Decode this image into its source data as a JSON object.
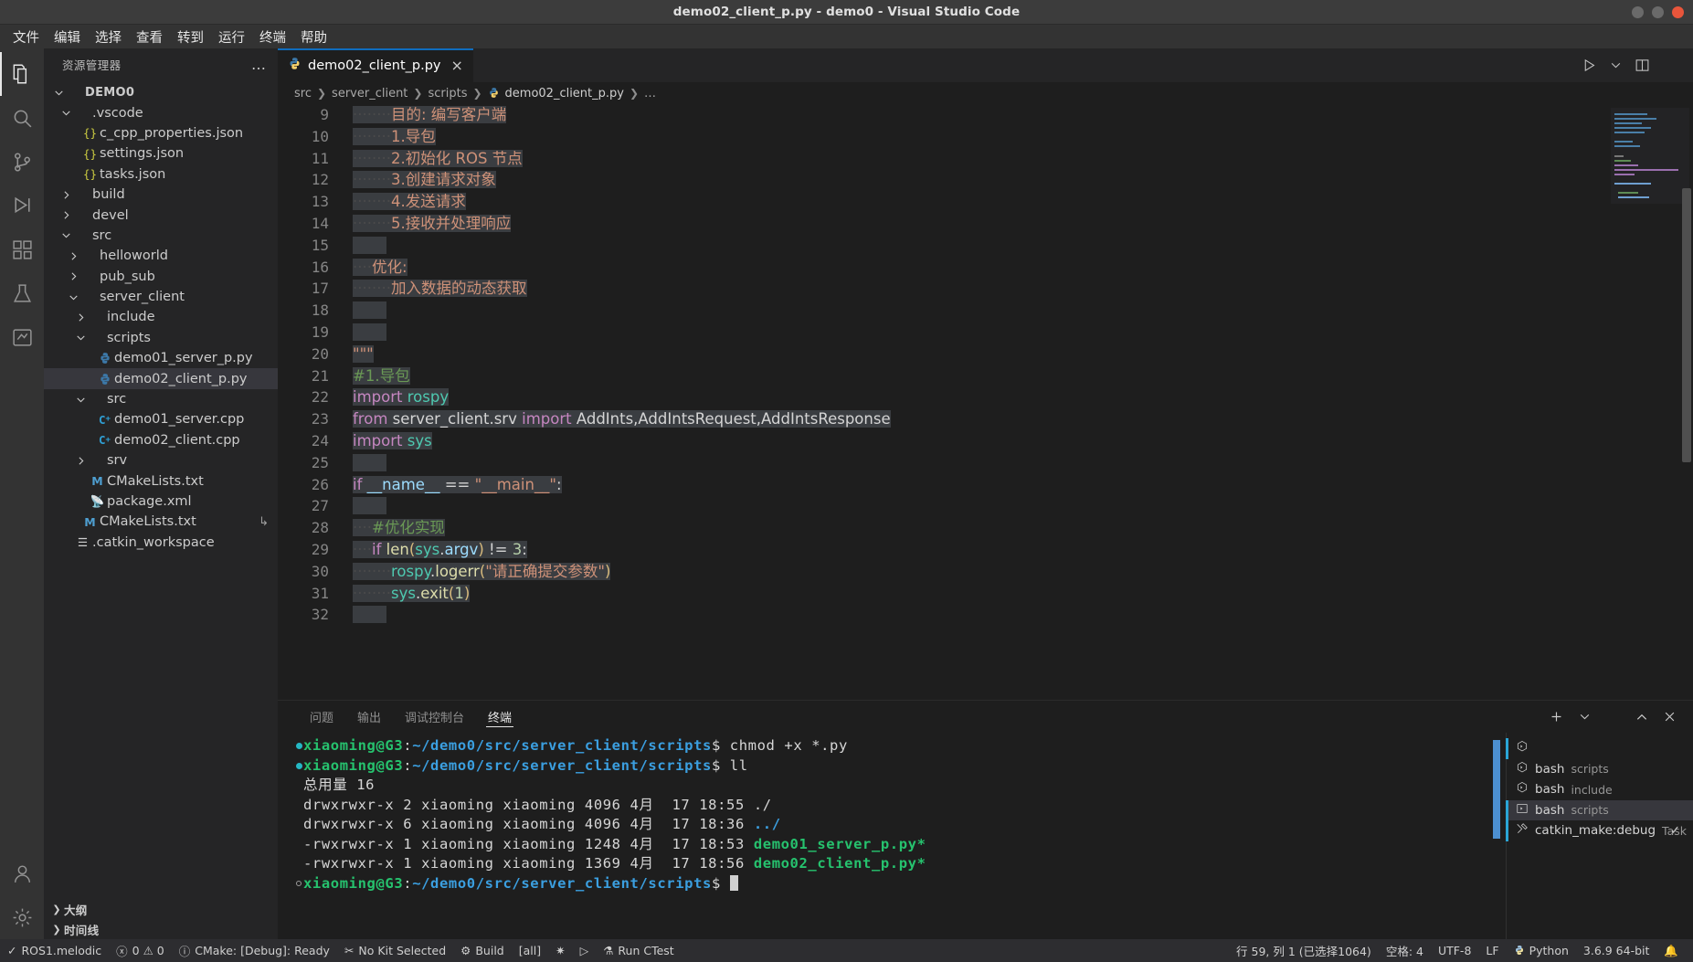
{
  "window": {
    "title": "demo02_client_p.py - demo0 - Visual Studio Code",
    "minimize_icon": "minimize-icon",
    "maximize_icon": "maximize-icon",
    "close_icon": "close-icon"
  },
  "menubar": {
    "items": [
      {
        "label": "文件"
      },
      {
        "label": "编辑"
      },
      {
        "label": "选择"
      },
      {
        "label": "查看"
      },
      {
        "label": "转到"
      },
      {
        "label": "运行"
      },
      {
        "label": "终端"
      },
      {
        "label": "帮助"
      }
    ]
  },
  "activitybar": {
    "items": [
      {
        "name": "explorer-icon",
        "active": true
      },
      {
        "name": "search-icon",
        "active": false
      },
      {
        "name": "source-control-icon",
        "active": false
      },
      {
        "name": "run-debug-icon",
        "active": false
      },
      {
        "name": "extensions-icon",
        "active": false
      },
      {
        "name": "testing-icon",
        "active": false
      },
      {
        "name": "cmake-icon",
        "active": false
      },
      {
        "name": "account-icon",
        "active": false
      },
      {
        "name": "settings-gear-icon",
        "active": false
      }
    ]
  },
  "sidebar": {
    "title": "资源管理器",
    "more_actions": "…",
    "tree": [
      {
        "label": "DEMO0",
        "indent": 0,
        "twisty": "down",
        "icon": "",
        "bold": true
      },
      {
        "label": ".vscode",
        "indent": 1,
        "twisty": "down",
        "icon": ""
      },
      {
        "label": "c_cpp_properties.json",
        "indent": 2,
        "twisty": "",
        "icon": "json"
      },
      {
        "label": "settings.json",
        "indent": 2,
        "twisty": "",
        "icon": "json"
      },
      {
        "label": "tasks.json",
        "indent": 2,
        "twisty": "",
        "icon": "json"
      },
      {
        "label": "build",
        "indent": 1,
        "twisty": "right",
        "icon": ""
      },
      {
        "label": "devel",
        "indent": 1,
        "twisty": "right",
        "icon": ""
      },
      {
        "label": "src",
        "indent": 1,
        "twisty": "down",
        "icon": ""
      },
      {
        "label": "helloworld",
        "indent": 2,
        "twisty": "right",
        "icon": ""
      },
      {
        "label": "pub_sub",
        "indent": 2,
        "twisty": "right",
        "icon": ""
      },
      {
        "label": "server_client",
        "indent": 2,
        "twisty": "down",
        "icon": ""
      },
      {
        "label": "include",
        "indent": 3,
        "twisty": "right",
        "icon": ""
      },
      {
        "label": "scripts",
        "indent": 3,
        "twisty": "down",
        "icon": ""
      },
      {
        "label": "demo01_server_p.py",
        "indent": 4,
        "twisty": "",
        "icon": "py"
      },
      {
        "label": "demo02_client_p.py",
        "indent": 4,
        "twisty": "",
        "icon": "py",
        "selected": true
      },
      {
        "label": "src",
        "indent": 3,
        "twisty": "down",
        "icon": ""
      },
      {
        "label": "demo01_server.cpp",
        "indent": 4,
        "twisty": "",
        "icon": "cpp"
      },
      {
        "label": "demo02_client.cpp",
        "indent": 4,
        "twisty": "",
        "icon": "cpp"
      },
      {
        "label": "srv",
        "indent": 3,
        "twisty": "right",
        "icon": ""
      },
      {
        "label": "CMakeLists.txt",
        "indent": 3,
        "twisty": "",
        "icon": "m"
      },
      {
        "label": "package.xml",
        "indent": 3,
        "twisty": "",
        "icon": "xml"
      },
      {
        "label": "CMakeLists.txt",
        "indent": 2,
        "twisty": "",
        "icon": "m",
        "end_glyph": "↳"
      },
      {
        "label": ".catkin_workspace",
        "indent": 1,
        "twisty": "",
        "icon": "txtlines"
      }
    ],
    "sections": [
      {
        "label": "大纲",
        "collapsed": true
      },
      {
        "label": "时间线",
        "collapsed": true
      }
    ]
  },
  "editor": {
    "tab": {
      "filename": "demo02_client_p.py",
      "icon": "python-icon",
      "close": "×"
    },
    "tab_actions": [
      {
        "name": "run-file-icon"
      },
      {
        "name": "chevron-down-icon"
      },
      {
        "name": "split-editor-icon"
      },
      {
        "name": "more-actions-icon"
      }
    ],
    "breadcrumb": [
      "src",
      "server_client",
      "scripts",
      "demo02_client_p.py",
      "…"
    ],
    "lines": [
      {
        "n": 9,
        "text": "        目的: 编写客户端"
      },
      {
        "n": 10,
        "text": "        1.导包"
      },
      {
        "n": 11,
        "text": "        2.初始化 ROS 节点"
      },
      {
        "n": 12,
        "text": "        3.创建请求对象"
      },
      {
        "n": 13,
        "text": "        4.发送请求"
      },
      {
        "n": 14,
        "text": "        5.接收并处理响应"
      },
      {
        "n": 15,
        "text": ""
      },
      {
        "n": 16,
        "text": "    优化:"
      },
      {
        "n": 17,
        "text": "        加入数据的动态获取"
      },
      {
        "n": 18,
        "text": ""
      },
      {
        "n": 19,
        "text": ""
      },
      {
        "n": 20,
        "text": "\"\"\""
      },
      {
        "n": 21,
        "text": "#1.导包"
      },
      {
        "n": 22,
        "text": "import rospy"
      },
      {
        "n": 23,
        "text": "from server_client.srv import AddInts,AddIntsRequest,AddIntsResponse"
      },
      {
        "n": 24,
        "text": "import sys"
      },
      {
        "n": 25,
        "text": ""
      },
      {
        "n": 26,
        "text": "if __name__ == \"__main__\":"
      },
      {
        "n": 27,
        "text": ""
      },
      {
        "n": 28,
        "text": "    #优化实现"
      },
      {
        "n": 29,
        "text": "    if len(sys.argv) != 3:"
      },
      {
        "n": 30,
        "text": "        rospy.logerr(\"请正确提交参数\")"
      },
      {
        "n": 31,
        "text": "        sys.exit(1)"
      },
      {
        "n": 32,
        "text": ""
      }
    ]
  },
  "panel": {
    "tabs": [
      {
        "label": "问题",
        "active": false
      },
      {
        "label": "输出",
        "active": false
      },
      {
        "label": "调试控制台",
        "active": false
      },
      {
        "label": "终端",
        "active": true
      }
    ],
    "actions": [
      {
        "name": "new-terminal-icon",
        "glyph": "+"
      },
      {
        "name": "chevron-down-icon",
        "glyph": "⌄"
      },
      {
        "name": "more-actions-icon",
        "glyph": "…"
      },
      {
        "name": "maximize-panel-icon",
        "glyph": "⌃"
      },
      {
        "name": "close-panel-icon",
        "glyph": "✕"
      }
    ],
    "terminal_lines": [
      {
        "marker": "dot",
        "user": "xiaoming@G3",
        "colon": ":",
        "path": "~/demo0/src/server_client/scripts",
        "prompt": "$",
        "cmd": " chmod +x *.py"
      },
      {
        "marker": "dot",
        "user": "xiaoming@G3",
        "colon": ":",
        "path": "~/demo0/src/server_client/scripts",
        "prompt": "$",
        "cmd": " ll"
      },
      {
        "marker": "",
        "plain": "总用量 16"
      },
      {
        "marker": "",
        "plain": "drwxrwxr-x 2 xiaoming xiaoming 4096 4月  17 18:55 ",
        "tail": "./",
        "tail_color": "plain"
      },
      {
        "marker": "",
        "plain": "drwxrwxr-x 6 xiaoming xiaoming 4096 4月  17 18:36 ",
        "tail": "../",
        "tail_color": "blue"
      },
      {
        "marker": "",
        "plain": "-rwxrwxr-x 1 xiaoming xiaoming 1248 4月  17 18:53 ",
        "tail": "demo01_server_p.py*",
        "tail_color": "green"
      },
      {
        "marker": "",
        "plain": "-rwxrwxr-x 1 xiaoming xiaoming 1369 4月  17 18:56 ",
        "tail": "demo02_client_p.py*",
        "tail_color": "green"
      },
      {
        "marker": "hollow",
        "user": "xiaoming@G3",
        "colon": ":",
        "path": "~/demo0/src/server_client/scripts",
        "prompt": "$",
        "cmd": " ",
        "cursor": true
      }
    ],
    "terminal_list": [
      {
        "icon": "terminal-bash-icon",
        "name": "",
        "meta": "",
        "selected": false,
        "indicator": true
      },
      {
        "icon": "terminal-bash-icon",
        "name": "bash",
        "meta": "scripts",
        "selected": false
      },
      {
        "icon": "terminal-bash-icon",
        "name": "bash",
        "meta": "include",
        "selected": false
      },
      {
        "icon": "terminal-chevron-icon",
        "name": "bash",
        "meta": "scripts",
        "selected": true,
        "indicator": true
      },
      {
        "icon": "tools-icon",
        "name": "catkin_make:debug",
        "meta": "Task",
        "selected": false,
        "check": "✓",
        "indicator": true
      }
    ]
  },
  "statusbar": {
    "left": [
      {
        "icon": "remote-check-icon",
        "label": "ROS1.melodic"
      },
      {
        "icon": "error-warning-icon",
        "label": "0 ⚠ 0"
      },
      {
        "icon": "info-icon",
        "label": "CMake: [Debug]: Ready"
      },
      {
        "icon": "kit-icon",
        "label": "No Kit Selected"
      },
      {
        "icon": "build-icon",
        "label": "Build"
      },
      {
        "icon": "target-icon",
        "label": "[all]"
      },
      {
        "icon": "debug-settings-icon",
        "label": ""
      },
      {
        "icon": "run-icon",
        "label": ""
      },
      {
        "icon": "ctest-icon",
        "label": "Run CTest"
      }
    ],
    "right": [
      {
        "label": "行 59, 列 1 (已选择1064)"
      },
      {
        "label": "空格: 4"
      },
      {
        "label": "UTF-8"
      },
      {
        "label": "LF"
      },
      {
        "icon": "python-icon",
        "label": "Python"
      },
      {
        "label": "3.6.9 64-bit"
      },
      {
        "icon": "bell-icon",
        "label": ""
      }
    ]
  },
  "colors": {
    "accent": "#0f6cbd",
    "titlebar_bg": "#3c3c3c",
    "sidebar_bg": "#252526",
    "editor_bg": "#1e1e1e",
    "statusbar_bg": "#2d2d30",
    "selection": "#3a3d41",
    "terminal_green": "#26c26e",
    "terminal_blue": "#3b9fe0"
  }
}
